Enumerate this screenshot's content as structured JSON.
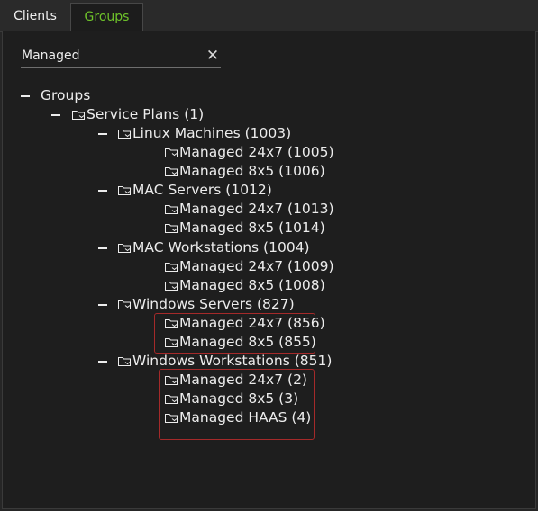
{
  "tabs": {
    "clients": "Clients",
    "groups": "Groups"
  },
  "search": {
    "value": "Managed",
    "clear_icon": "close-icon"
  },
  "tree": {
    "root": "Groups",
    "service_plans": "Service Plans (1)",
    "linux": {
      "label": "Linux Machines (1003)",
      "children": [
        "Managed 24x7 (1005)",
        "Managed 8x5 (1006)"
      ]
    },
    "mac_servers": {
      "label": "MAC Servers (1012)",
      "children": [
        "Managed 24x7 (1013)",
        "Managed 8x5 (1014)"
      ]
    },
    "mac_workstations": {
      "label": "MAC Workstations (1004)",
      "children": [
        "Managed 24x7 (1009)",
        "Managed 8x5 (1008)"
      ]
    },
    "windows_servers": {
      "label": "Windows Servers (827)",
      "children": [
        "Managed 24x7 (856)",
        "Managed 8x5 (855)"
      ]
    },
    "windows_workstations": {
      "label": "Windows Workstations (851)",
      "children": [
        "Managed 24x7 (2)",
        "Managed 8x5 (3)",
        "Managed HAAS (4)"
      ]
    }
  },
  "colors": {
    "active_tab": "#6ec22a",
    "highlight_box": "#a52a2a"
  }
}
